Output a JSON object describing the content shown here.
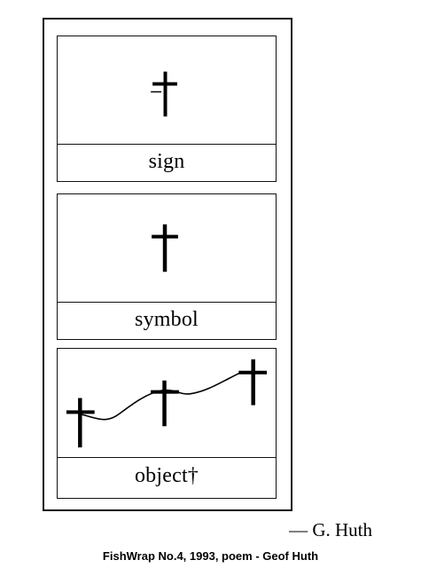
{
  "poem": {
    "panels": [
      {
        "label": "sign"
      },
      {
        "label": "symbol"
      },
      {
        "label": "object†"
      }
    ],
    "signature": "— G. Huth"
  },
  "caption": "FishWrap No.4, 1993, poem - Geof Huth",
  "colors": {
    "ink": "#000000",
    "paper": "#ffffff"
  },
  "icons": {
    "cross": "cross-icon"
  }
}
